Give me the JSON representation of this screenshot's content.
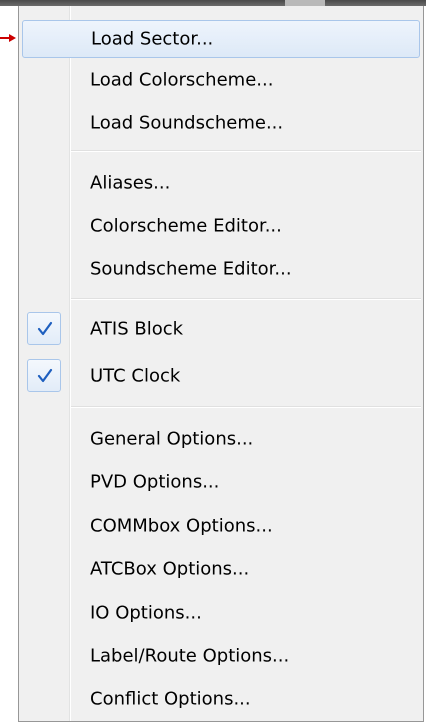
{
  "menu": {
    "groups": [
      {
        "items": [
          {
            "label": "Load Sector...",
            "highlighted": true
          },
          {
            "label": "Load Colorscheme..."
          },
          {
            "label": "Load Soundscheme..."
          }
        ]
      },
      {
        "items": [
          {
            "label": "Aliases..."
          },
          {
            "label": "Colorscheme Editor..."
          },
          {
            "label": "Soundscheme Editor..."
          }
        ]
      },
      {
        "items": [
          {
            "label": "ATIS Block",
            "checked": true
          },
          {
            "label": "UTC Clock",
            "checked": true
          }
        ]
      },
      {
        "items": [
          {
            "label": "General Options..."
          },
          {
            "label": "PVD Options..."
          },
          {
            "label": "COMMbox Options..."
          },
          {
            "label": "ATCBox Options..."
          },
          {
            "label": "IO Options..."
          },
          {
            "label": "Label/Route Options..."
          },
          {
            "label": "Conflict Options..."
          }
        ]
      }
    ]
  },
  "colors": {
    "highlight_border": "#a9c6ea",
    "check_mark": "#1e5fbf",
    "pointer_arrow": "#cc0000"
  },
  "icons": {
    "pointer": "arrow-pointer-icon",
    "check": "checkmark-icon"
  }
}
